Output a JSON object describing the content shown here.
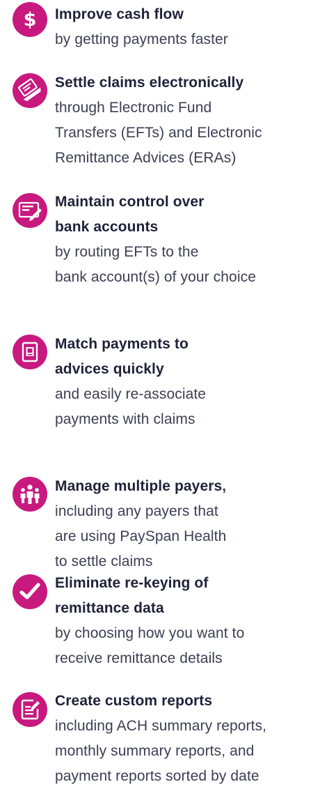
{
  "benefits": [
    {
      "icon": "dollar-icon",
      "title_lines": [
        "Improve cash flow"
      ],
      "desc_lines": [
        "by getting payments faster"
      ]
    },
    {
      "icon": "laptop-icon",
      "title_lines": [
        "Settle claims electronically"
      ],
      "desc_lines": [
        "through Electronic Fund",
        "Transfers (EFTs) and Electronic",
        "Remittance Advices (ERAs)"
      ]
    },
    {
      "icon": "check-pen-icon",
      "title_lines": [
        "Maintain control over",
        "bank accounts"
      ],
      "desc_lines": [
        "by routing EFTs to the",
        "bank account(s) of your choice"
      ]
    },
    {
      "icon": "document-icon",
      "title_lines": [
        "Match payments to",
        "advices quickly"
      ],
      "desc_lines": [
        "and easily re-associate",
        "payments with claims"
      ]
    },
    {
      "icon": "people-icon",
      "title": "Manage multiple payers",
      "title_suffix": ",",
      "desc_lines": [
        "including any payers that",
        "are using PaySpan Health",
        "to settle claims"
      ]
    },
    {
      "icon": "checkmark-icon",
      "title_lines": [
        "Eliminate re-keying of",
        "remittance data"
      ],
      "desc_lines": [
        "by choosing how you want to",
        "receive remittance details"
      ]
    },
    {
      "icon": "report-icon",
      "title_lines": [
        "Create custom reports"
      ],
      "desc_lines": [
        "including ACH summary reports,",
        "monthly summary reports, and",
        "payment reports sorted by date"
      ]
    }
  ],
  "colors": {
    "accent": "#c8197f",
    "title_text": "#1e2239",
    "body_text": "#3a3f52"
  }
}
